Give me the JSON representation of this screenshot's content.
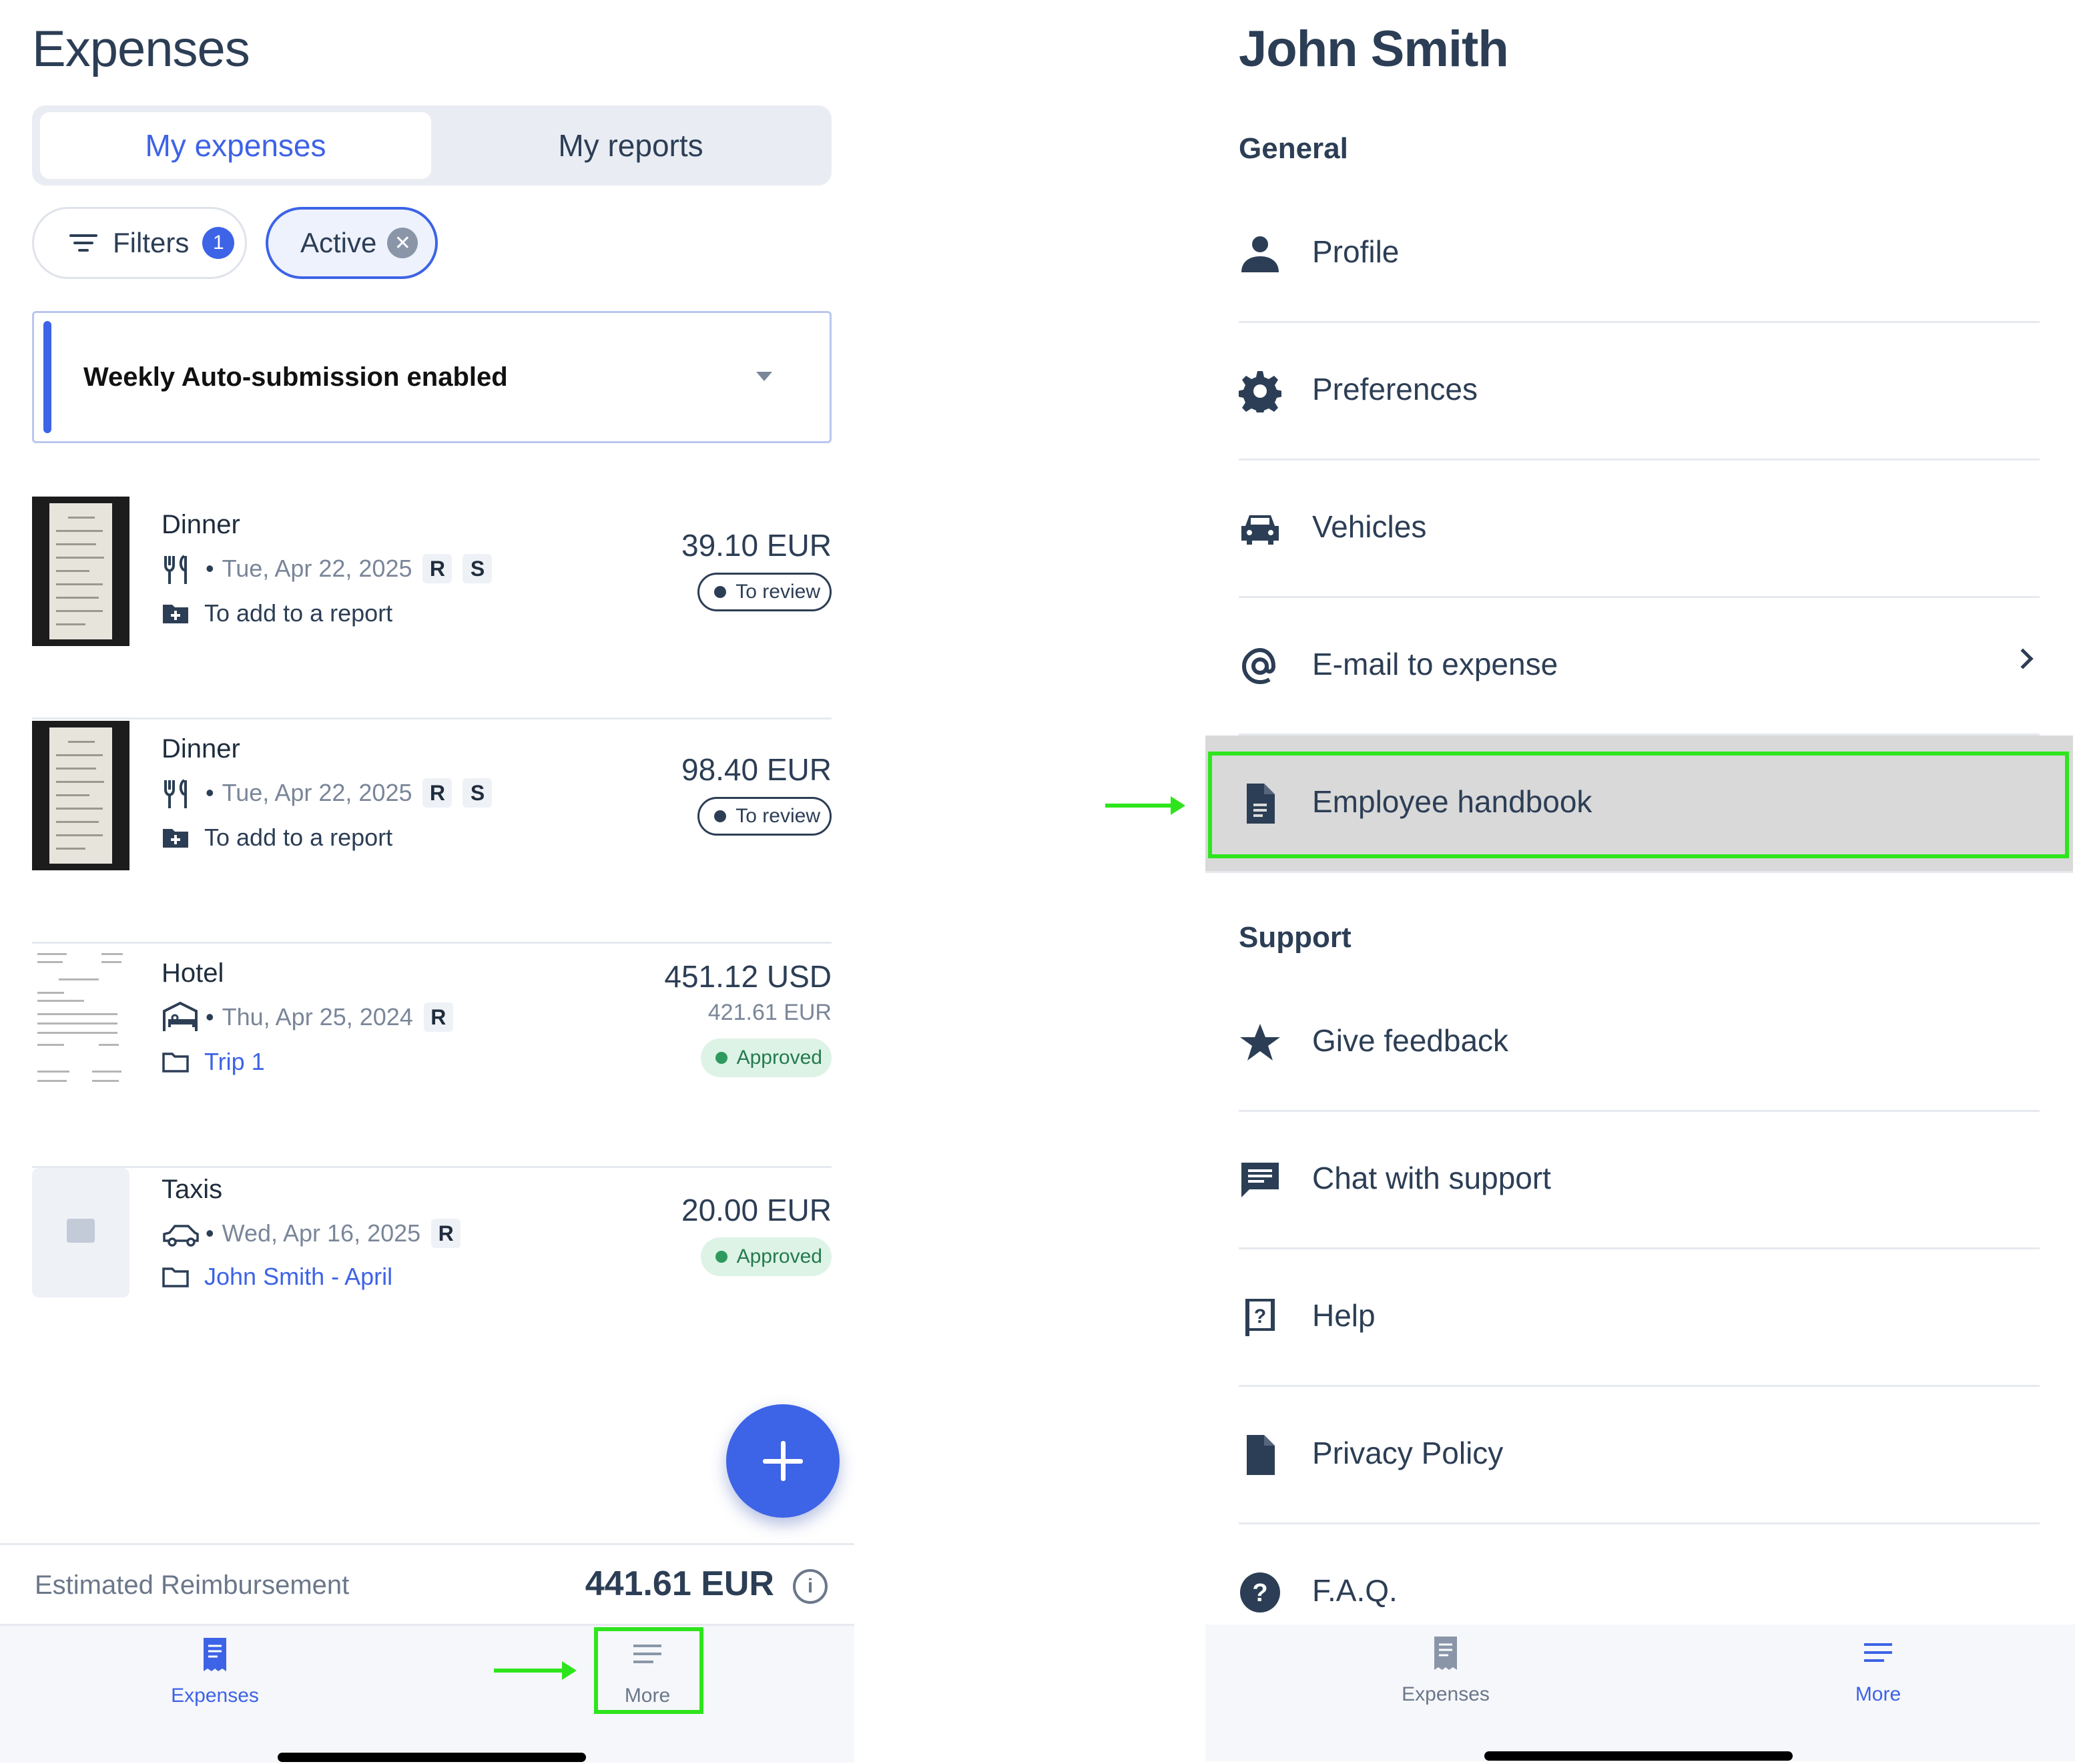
{
  "left": {
    "title": "Expenses",
    "segments": {
      "active": "My expenses",
      "inactive": "My reports"
    },
    "filters_chip": {
      "label": "Filters",
      "count": "1"
    },
    "active_chip": {
      "label": "Active",
      "close": "✕"
    },
    "banner": {
      "text": "Weekly Auto-submission enabled"
    },
    "expenses": [
      {
        "title": "Dinner",
        "category_icon": "fork-knife-icon",
        "date": "Tue, Apr 22, 2025",
        "tags": [
          "R",
          "S"
        ],
        "report_icon": "add-to-report-icon",
        "report": "To add to a report",
        "amount": "39.10 EUR",
        "converted": "",
        "status": "To review"
      },
      {
        "title": "Dinner",
        "category_icon": "fork-knife-icon",
        "date": "Tue, Apr 22, 2025",
        "tags": [
          "R",
          "S"
        ],
        "report_icon": "add-to-report-icon",
        "report": "To add to a report",
        "amount": "98.40 EUR",
        "converted": "",
        "status": "To review"
      },
      {
        "title": "Hotel",
        "category_icon": "bed-icon",
        "date": "Thu, Apr 25, 2024",
        "tags": [
          "R"
        ],
        "report_icon": "folder-icon",
        "report": "Trip 1",
        "amount": "451.12 USD",
        "converted": "421.61  EUR",
        "status": "Approved"
      },
      {
        "title": "Taxis",
        "category_icon": "car-icon",
        "date": "Wed, Apr 16, 2025",
        "tags": [
          "R"
        ],
        "report_icon": "folder-icon",
        "report": "John Smith - April",
        "amount": "20.00 EUR",
        "converted": "",
        "status": "Approved"
      }
    ],
    "reimbursement": {
      "label": "Estimated Reimbursement",
      "value": "441.61 EUR",
      "info": "i"
    },
    "tabs": {
      "expenses": "Expenses",
      "more": "More"
    }
  },
  "right": {
    "title": "John Smith",
    "general_heading": "General",
    "general_items": [
      {
        "label": "Profile",
        "icon": "person-icon"
      },
      {
        "label": "Preferences",
        "icon": "gear-icon"
      },
      {
        "label": "Vehicles",
        "icon": "car-icon"
      },
      {
        "label": "E-mail to expense",
        "icon": "at-sign-icon"
      },
      {
        "label": "Employee handbook",
        "icon": "document-icon"
      }
    ],
    "support_heading": "Support",
    "support_items": [
      {
        "label": "Give feedback",
        "icon": "star-icon"
      },
      {
        "label": "Chat with support",
        "icon": "chat-icon"
      },
      {
        "label": "Help",
        "icon": "help-book-icon"
      },
      {
        "label": "Privacy Policy",
        "icon": "file-icon"
      },
      {
        "label": "F.A.Q.",
        "icon": "question-circle-icon"
      }
    ],
    "tabs": {
      "expenses": "Expenses",
      "more": "More"
    }
  },
  "colors": {
    "accent": "#3d63e6",
    "text_dark": "#2c3e55",
    "highlight": "#2ee51d",
    "approved_bg": "#ddf3e6",
    "approved_fg": "#247a4d",
    "selected_row": "#d9d9d9"
  }
}
